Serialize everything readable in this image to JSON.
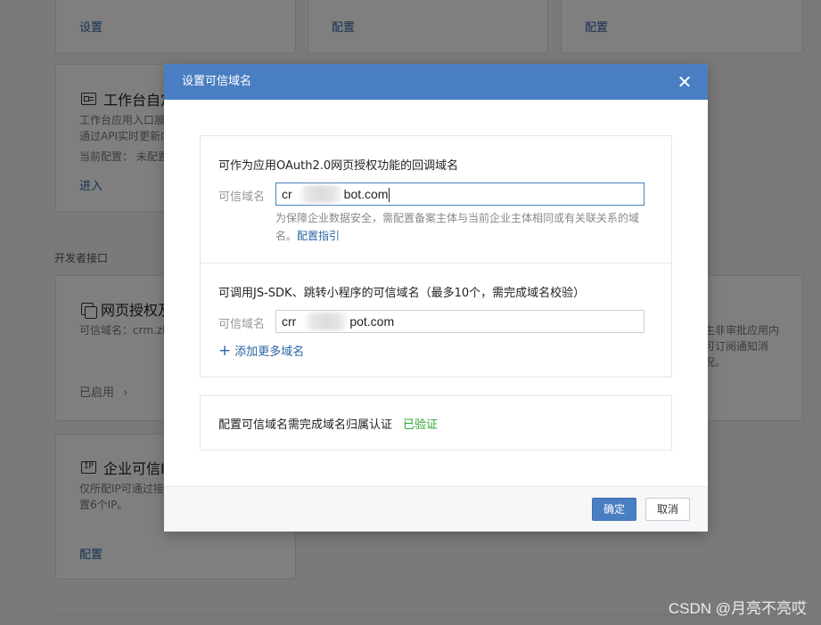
{
  "background": {
    "top_cards": [
      {
        "link": "设置"
      },
      {
        "link": "配置"
      },
      {
        "link": "配置"
      }
    ],
    "workbench": {
      "title": "工作台自定",
      "desc1": "工作台应用入口展",
      "desc2": "通过API实时更新内",
      "current": "当前配置：  未配置",
      "link": "进入"
    },
    "section_label": "开发者接口",
    "oauth_card": {
      "title": "网页授权及",
      "desc": "可信域名：crm.zh",
      "status": "已启用",
      "chevron": "›"
    },
    "ip_card": {
      "title": "企业可信I",
      "desc1": "仅所配IP可通过接",
      "desc2": "置6个IP。",
      "link": "配置"
    },
    "right_card": {
      "line1": "生非审批应用内",
      "line2": "可订阅通知消",
      "line3": "况。"
    }
  },
  "dialog": {
    "title": "设置可信域名",
    "close_icon": "close-icon",
    "oauth_section": {
      "title": "可作为应用OAuth2.0网页授权功能的回调域名",
      "label": "可信域名",
      "value_prefix": "cr",
      "value_suffix": "bot.com",
      "hint": "为保障企业数据安全，需配置备案主体与当前企业主体相同或有关联关系的域名。",
      "hint_link": "配置指引"
    },
    "jssdk_section": {
      "title": "可调用JS-SDK、跳转小程序的可信域名（最多10个，需完成域名校验）",
      "label": "可信域名",
      "value_prefix": "crr",
      "value_suffix": "pot.com",
      "add_more": "添加更多域名"
    },
    "verification": {
      "text": "配置可信域名需完成域名归属认证",
      "status": "已验证",
      "status_color": "#2fa32f"
    },
    "confirm": "确定",
    "cancel": "取消"
  },
  "watermark": "CSDN @月亮不亮哎",
  "colors": {
    "header": "#4a7ec2",
    "link": "#2b64a4"
  }
}
